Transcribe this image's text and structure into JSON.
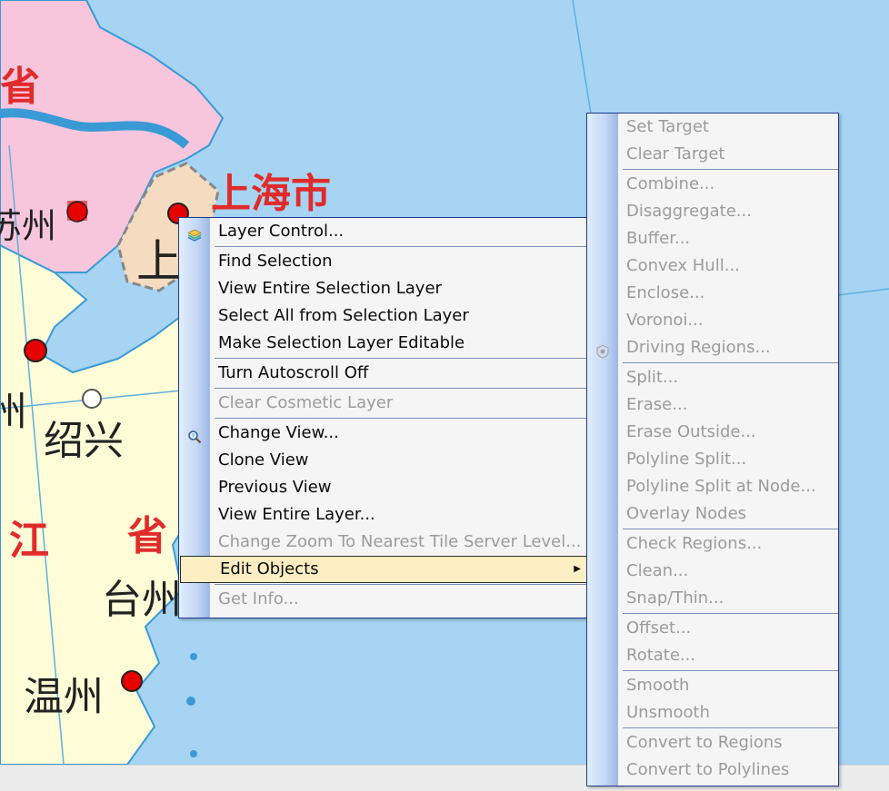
{
  "map": {
    "labels": {
      "province_top": "省",
      "shanghai_city": "上海市",
      "shanghai_short": "上",
      "suzhou": "苏州",
      "hangzhou_part": "州",
      "shaoxing": "绍兴",
      "zhejiang_jiang": "江",
      "zhejiang_sheng": "省",
      "taizhou": "台州",
      "wenzhou": "温州"
    },
    "colors": {
      "sea": "#a6d4f2",
      "jiangsu": "#f7c6dc",
      "zhejiang": "#fffcd8",
      "shanghai": "#f5dcc0",
      "province_label": "#e12b2b",
      "city_marker": "#e60000"
    }
  },
  "context_menu": {
    "items": [
      {
        "label": "Layer Control...",
        "icon": "layers-icon",
        "enabled": true
      },
      {
        "separator": true
      },
      {
        "label": "Find Selection",
        "enabled": true
      },
      {
        "label": "View Entire Selection Layer",
        "enabled": true
      },
      {
        "label": "Select All from Selection Layer",
        "enabled": true
      },
      {
        "label": "Make Selection Layer Editable",
        "enabled": true
      },
      {
        "separator": true
      },
      {
        "label": "Turn Autoscroll Off",
        "enabled": true
      },
      {
        "separator": true
      },
      {
        "label": "Clear Cosmetic Layer",
        "enabled": false
      },
      {
        "separator": true
      },
      {
        "label": "Change View...",
        "icon": "magnifier-icon",
        "enabled": true
      },
      {
        "label": "Clone View",
        "enabled": true
      },
      {
        "label": "Previous View",
        "enabled": true
      },
      {
        "label": "View Entire Layer...",
        "enabled": true
      },
      {
        "label": "Change Zoom To Nearest Tile Server Level...",
        "enabled": false
      },
      {
        "label": "Edit Objects",
        "enabled": true,
        "highlighted": true,
        "submenu": true
      },
      {
        "separator": true
      },
      {
        "label": "Get Info...",
        "enabled": false
      }
    ]
  },
  "edit_objects_menu": {
    "items": [
      {
        "label": "Set Target",
        "enabled": false
      },
      {
        "label": "Clear Target",
        "enabled": false
      },
      {
        "separator": true
      },
      {
        "label": "Combine...",
        "enabled": false
      },
      {
        "label": "Disaggregate...",
        "enabled": false
      },
      {
        "label": "Buffer...",
        "enabled": false
      },
      {
        "label": "Convex Hull...",
        "enabled": false
      },
      {
        "label": "Enclose...",
        "enabled": false
      },
      {
        "label": "Voronoi...",
        "enabled": false
      },
      {
        "label": "Driving Regions...",
        "icon": "driving-regions-icon",
        "enabled": false
      },
      {
        "separator": true
      },
      {
        "label": "Split...",
        "enabled": false
      },
      {
        "label": "Erase...",
        "enabled": false
      },
      {
        "label": "Erase Outside...",
        "enabled": false
      },
      {
        "label": "Polyline Split...",
        "enabled": false
      },
      {
        "label": "Polyline Split at Node...",
        "enabled": false
      },
      {
        "label": "Overlay Nodes",
        "enabled": false
      },
      {
        "separator": true
      },
      {
        "label": "Check Regions...",
        "enabled": false
      },
      {
        "label": "Clean...",
        "enabled": false
      },
      {
        "label": "Snap/Thin...",
        "enabled": false
      },
      {
        "separator": true
      },
      {
        "label": "Offset...",
        "enabled": false
      },
      {
        "label": "Rotate...",
        "enabled": false
      },
      {
        "separator": true
      },
      {
        "label": "Smooth",
        "enabled": false
      },
      {
        "label": "Unsmooth",
        "enabled": false
      },
      {
        "separator": true
      },
      {
        "label": "Convert to Regions",
        "enabled": false
      },
      {
        "label": "Convert to Polylines",
        "enabled": false
      }
    ]
  }
}
